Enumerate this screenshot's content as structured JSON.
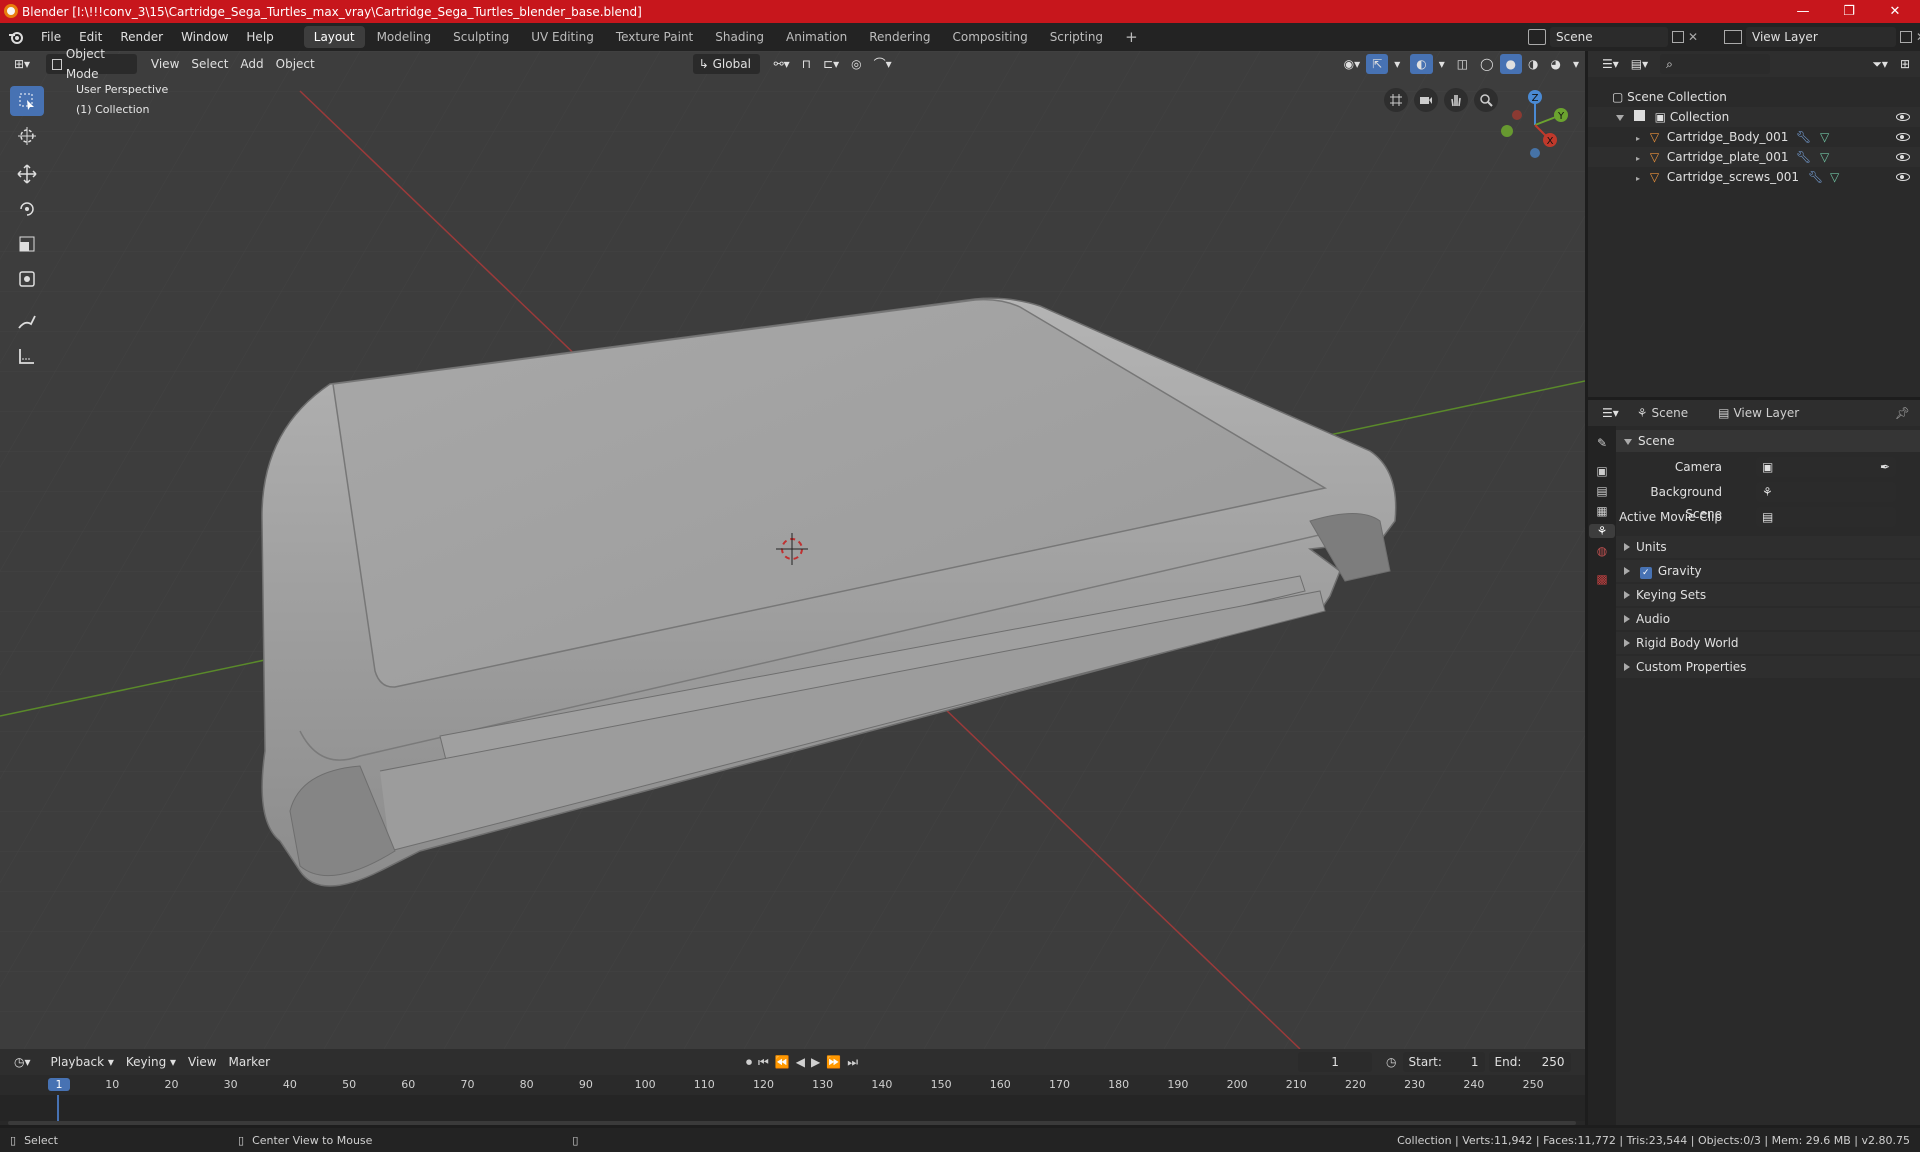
{
  "window": {
    "title": "Blender [I:\\!!!conv_3\\15\\Cartridge_Sega_Turtles_max_vray\\Cartridge_Sega_Turtles_blender_base.blend]",
    "minimize": "—",
    "maximize": "❐",
    "close": "✕"
  },
  "menu": [
    "File",
    "Edit",
    "Render",
    "Window",
    "Help"
  ],
  "workspaces": [
    "Layout",
    "Modeling",
    "Sculpting",
    "UV Editing",
    "Texture Paint",
    "Shading",
    "Animation",
    "Rendering",
    "Compositing",
    "Scripting"
  ],
  "workspace_add": "+",
  "scene_field": "Scene",
  "view_layer_field": "View Layer",
  "viewport": {
    "mode": "Object Mode",
    "menus": [
      "View",
      "Select",
      "Add",
      "Object"
    ],
    "orientation": "Global",
    "overlay_title": "User Perspective",
    "overlay_collection": "(1) Collection",
    "gizmo": {
      "z": "Z",
      "y": "Y",
      "x": "X"
    }
  },
  "outliner": {
    "search_placeholder": "",
    "root": "Scene Collection",
    "collection": "Collection",
    "items": [
      "Cartridge_Body_001",
      "Cartridge_plate_001",
      "Cartridge_screws_001"
    ]
  },
  "properties": {
    "tab_scene": "Scene",
    "tab_view_layer": "View Layer",
    "section": "Scene",
    "fields": [
      {
        "label": "Camera",
        "value": ""
      },
      {
        "label": "Background Scene",
        "value": ""
      },
      {
        "label": "Active Movie Clip",
        "value": ""
      }
    ],
    "panels": [
      "Units",
      "Gravity",
      "Keying Sets",
      "Audio",
      "Rigid Body World",
      "Custom Properties"
    ],
    "gravity_checked": true
  },
  "timeline": {
    "menus": [
      "Playback",
      "Keying",
      "View",
      "Marker"
    ],
    "current_frame": "1",
    "start_label": "Start:",
    "start": "1",
    "end_label": "End:",
    "end": "250",
    "ruler": [
      "1",
      "10",
      "20",
      "30",
      "40",
      "50",
      "60",
      "70",
      "80",
      "90",
      "100",
      "110",
      "120",
      "130",
      "140",
      "150",
      "160",
      "170",
      "180",
      "190",
      "200",
      "210",
      "220",
      "230",
      "240",
      "250"
    ]
  },
  "status": {
    "select": "Select",
    "center": "Center View to Mouse",
    "stats": "Collection | Verts:11,942 | Faces:11,772 | Tris:23,544 | Objects:0/3 | Mem: 29.6 MB | v2.80.75"
  },
  "colors": {
    "titlebar": "#c7161c",
    "select_blue": "#4772b3",
    "axis_x": "#c0392b",
    "axis_y": "#6ba32f",
    "mesh_icon": "#e8903a"
  }
}
